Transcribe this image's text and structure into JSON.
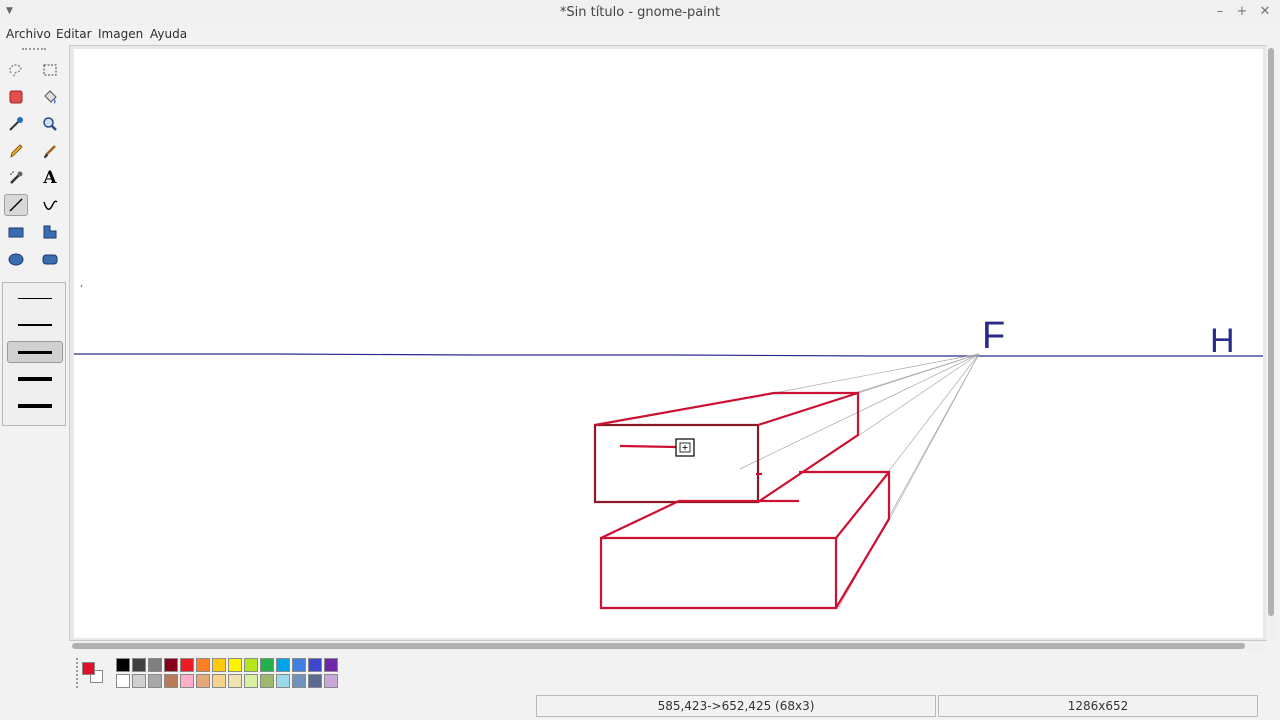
{
  "window": {
    "title": "*Sin título - gnome-paint",
    "menu_glyph": "▼",
    "minimize": "–",
    "maximize": "+",
    "close": "✕"
  },
  "menubar": [
    "Archivo",
    "Editar",
    "Imagen",
    "Ayuda"
  ],
  "tools": [
    {
      "name": "free-select-icon"
    },
    {
      "name": "rect-select-icon"
    },
    {
      "name": "eraser-icon"
    },
    {
      "name": "fill-bucket-icon"
    },
    {
      "name": "color-picker-icon"
    },
    {
      "name": "magnify-icon"
    },
    {
      "name": "pencil-icon"
    },
    {
      "name": "brush-icon"
    },
    {
      "name": "airbrush-icon"
    },
    {
      "name": "text-icon",
      "label": "A"
    },
    {
      "name": "line-icon",
      "active": true
    },
    {
      "name": "curve-icon"
    },
    {
      "name": "rectangle-icon"
    },
    {
      "name": "polygon-icon"
    },
    {
      "name": "ellipse-icon"
    },
    {
      "name": "rounded-rect-icon"
    }
  ],
  "line_widths": [
    "1",
    "2",
    "3",
    "4",
    "5"
  ],
  "selected_line_width": "3",
  "canvas": {
    "text_f": "F",
    "text_h": "H",
    "stroke_color_red": "#cc1133",
    "stroke_color_blue": "#2a2a8a"
  },
  "colors": {
    "foreground": "#e0102a",
    "background": "#ffffff",
    "row1": [
      "#000000",
      "#404040",
      "#7f7f7f",
      "#880015",
      "#ed1c24",
      "#ff7f27",
      "#ffc90e",
      "#fff200",
      "#b5e61d",
      "#22b14c",
      "#00a2e8",
      "#3f80e0",
      "#3f48cc",
      "#7028a8"
    ],
    "row2": [
      "#ffffff",
      "#d0d0d0",
      "#a8a8a8",
      "#b97a57",
      "#ffaec9",
      "#e6a878",
      "#f5d38a",
      "#efe4b0",
      "#d8f0a0",
      "#9cb86c",
      "#99d9ea",
      "#7092be",
      "#5a6a90",
      "#c8a8d8"
    ]
  },
  "status": {
    "selection": "585,423->652,425 (68x3)",
    "image_size": "1286x652"
  }
}
